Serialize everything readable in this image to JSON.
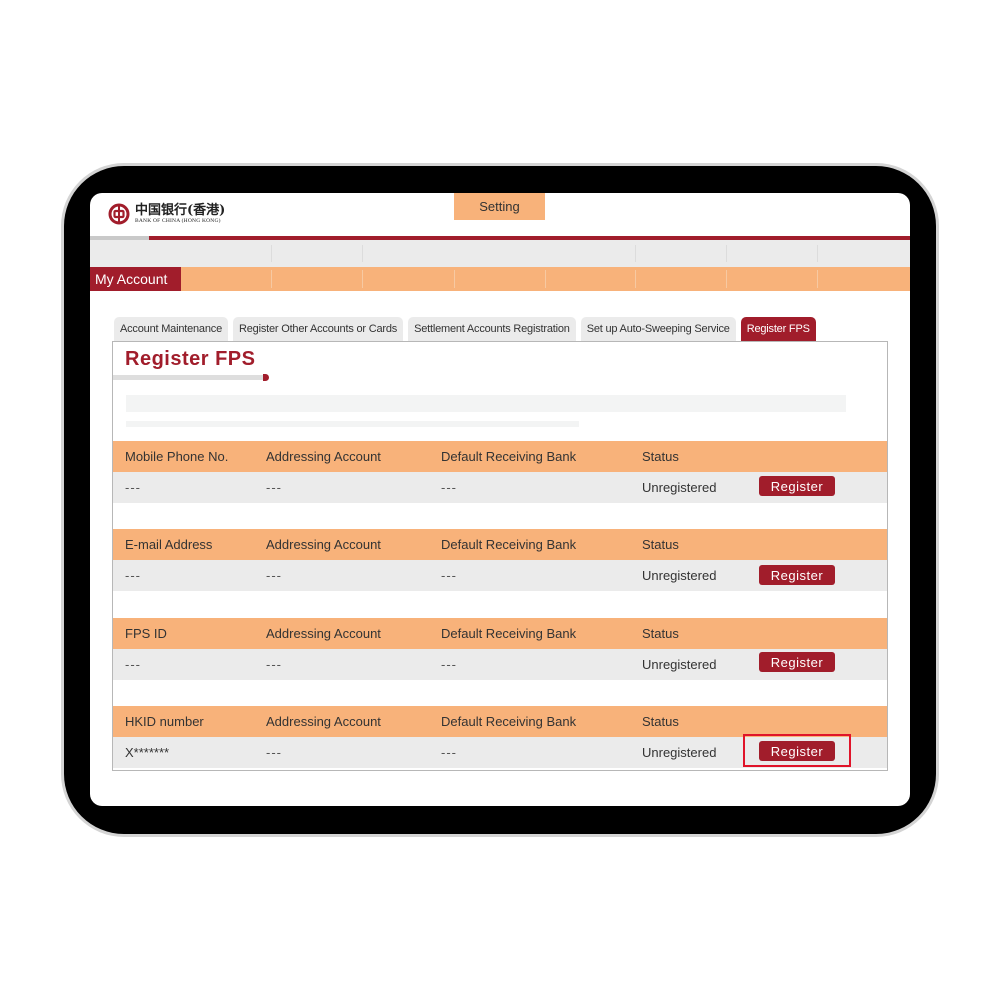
{
  "brand": {
    "name_cn": "中国银行(香港)",
    "name_en": "BANK OF CHINA (HONG KONG)",
    "primary_color": "#a11d2b",
    "accent_color": "#f8b27a"
  },
  "nav": {
    "active_item": "Setting",
    "section": "My Account"
  },
  "tabs": [
    {
      "label": "Account Maintenance",
      "active": false
    },
    {
      "label": "Register Other Accounts or Cards",
      "active": false
    },
    {
      "label": "Settlement Accounts Registration",
      "active": false
    },
    {
      "label": "Set up Auto-Sweeping Service",
      "active": false
    },
    {
      "label": "Register FPS",
      "active": true
    }
  ],
  "page": {
    "title": "Register FPS"
  },
  "sections": [
    {
      "headers": [
        "Mobile Phone No.",
        "Addressing Account",
        "Default Receiving Bank",
        "Status"
      ],
      "row": {
        "id_value": "---",
        "addressing_account": "---",
        "default_bank": "---",
        "status": "Unregistered",
        "action": "Register"
      }
    },
    {
      "headers": [
        "E-mail Address",
        "Addressing Account",
        "Default Receiving Bank",
        "Status"
      ],
      "row": {
        "id_value": "---",
        "addressing_account": "---",
        "default_bank": "---",
        "status": "Unregistered",
        "action": "Register"
      }
    },
    {
      "headers": [
        "FPS ID",
        "Addressing Account",
        "Default Receiving Bank",
        "Status"
      ],
      "row": {
        "id_value": "---",
        "addressing_account": "---",
        "default_bank": "---",
        "status": "Unregistered",
        "action": "Register"
      }
    },
    {
      "headers": [
        "HKID number",
        "Addressing Account",
        "Default Receiving Bank",
        "Status"
      ],
      "row": {
        "id_value": "X*******",
        "addressing_account": "---",
        "default_bank": "---",
        "status": "Unregistered",
        "action": "Register",
        "highlighted": true
      }
    }
  ]
}
